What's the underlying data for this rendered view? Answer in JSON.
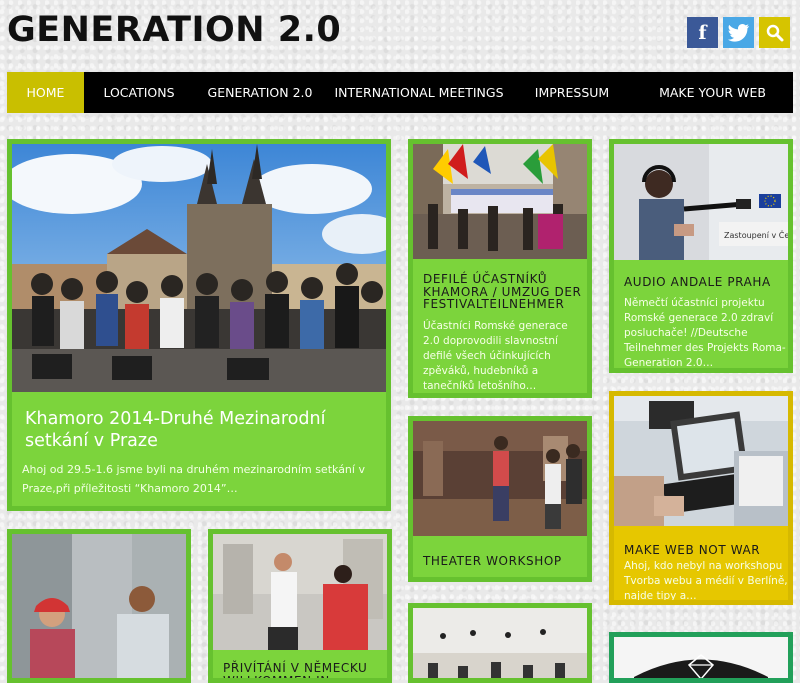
{
  "site": {
    "title": "GENERATION 2.0"
  },
  "social": {
    "facebook": "f",
    "twitter": "twitter-icon",
    "search": "search-icon"
  },
  "nav": [
    {
      "label": "HOME",
      "active": true
    },
    {
      "label": "LOCATIONS"
    },
    {
      "label": "GENERATION 2.0"
    },
    {
      "label": "INTERNATIONAL MEETINGS"
    },
    {
      "label": "IMPRESSUM"
    },
    {
      "label": "MAKE YOUR WEB"
    }
  ],
  "posts": {
    "featured": {
      "title": "Khamoro 2014-Druhé Mezinarodní setkání v Praze",
      "excerpt": "Ahoj od 29.5-1.6 jsme byli na druhém mezinarodním setkání v Praze,při příležitosti “Khamoro 2014”…"
    },
    "defile": {
      "title": "DEFILÉ ÚČASTNÍKŮ KHAMORA / UMZUG DER FESTIVALTEILNEHMER",
      "excerpt": "Účastníci Romské generace 2.0 doprovodili slavnostní defilé všech účinkujících zpěváků, hudebníků a tanečníků letošního…"
    },
    "audio": {
      "title": "AUDIO ANDALE PRAHA",
      "excerpt": "Němečtí účastníci projektu Romské generace 2.0 zdraví posluchače! //Deutsche Teilnehmer des Projekts Roma-Generation 2.0…",
      "sign_text": "Zastoupení v Če"
    },
    "theater": {
      "title": "THEATER WORKSHOP"
    },
    "makeweb": {
      "title": "MAKE WEB NOT WAR",
      "excerpt": "Ahoj, kdo nebyl na workshopu Tvorba webu a médií v Berlíně, najde tipy a…"
    },
    "welcome": {
      "title": "PŘIVÍTÁNÍ V NĚMECKU WILLKOMMEN IN"
    }
  },
  "colors": {
    "card_green": "#7cd43c",
    "card_yellow": "#e6c700",
    "nav_active": "#c9bf00",
    "facebook": "#3b5998",
    "twitter": "#4aa8e6",
    "search": "#d6c400"
  }
}
